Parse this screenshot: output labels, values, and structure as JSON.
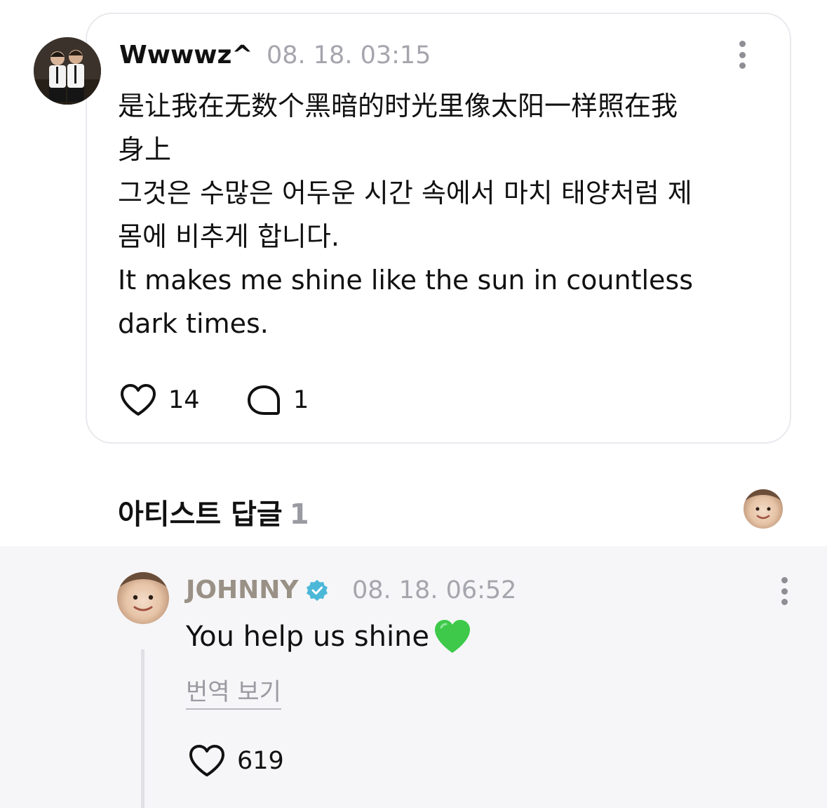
{
  "comment": {
    "username": "Wwwwz^",
    "timestamp": "08. 18. 03:15",
    "text_lines": [
      "是让我在无数个黑暗的时光里像太阳一样照在我",
      "身上",
      "그것은 수많은 어두운 시간 속에서 마치 태양처럼 제",
      "몸에 비추게 합니다.",
      "It makes me shine like the sun in countless",
      "dark times."
    ],
    "like_count": "14",
    "reply_count": "1",
    "icons": {
      "like": "heart-outline-icon",
      "reply": "speech-bubble-icon",
      "more": "kebab-menu-icon"
    }
  },
  "artist_reply_section": {
    "title": "아티스트 답글",
    "count": "1"
  },
  "reply": {
    "artist_name": "JOHNNY",
    "verified": true,
    "timestamp": "08. 18. 06:52",
    "text": "You help us shine",
    "emoji": "green-heart-icon",
    "translate_label": "번역 보기",
    "like_count": "619",
    "colors": {
      "artist_name": "#9a9186",
      "verified_badge": "#4cb8d8",
      "emoji_heart": "#3ec94a"
    }
  }
}
